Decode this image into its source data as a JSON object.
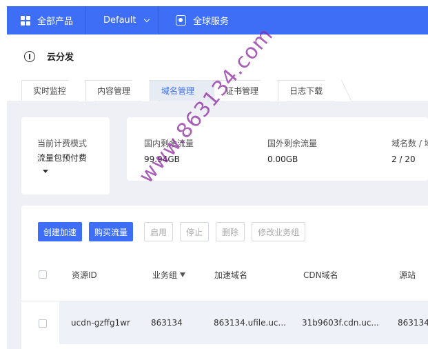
{
  "topnav": {
    "products_label": "全部产品",
    "project_label": "Default",
    "services_label": "全球服务"
  },
  "header": {
    "title": "云分发"
  },
  "tabs": [
    {
      "label": "实时监控",
      "active": false
    },
    {
      "label": "内容管理",
      "active": false
    },
    {
      "label": "域名管理",
      "active": true
    },
    {
      "label": "证书管理",
      "active": false
    },
    {
      "label": "日志下载",
      "active": false
    }
  ],
  "billing": {
    "label": "当前计费模式",
    "value": "流量包预付费"
  },
  "stats": [
    {
      "label": "国内剩余流量",
      "value": "99.94GB"
    },
    {
      "label": "国外剩余流量",
      "value": "0.00GB"
    },
    {
      "label": "域名数 / 域名上限",
      "value": "2 / 20"
    }
  ],
  "toolbar": {
    "create_label": "创建加速",
    "buy_label": "购买流量",
    "start_label": "启用",
    "stop_label": "停止",
    "delete_label": "删除",
    "edit_group_label": "修改业务组"
  },
  "table": {
    "columns": [
      "资源ID",
      "业务组",
      "加速域名",
      "CDN域名",
      "源站"
    ],
    "rows": [
      [
        "ucdn-gzffg1wr",
        "863134",
        "863134.ufile.uc...",
        "31b9603f.cdn.uc...",
        "863134"
      ]
    ]
  },
  "watermark": "www.863134.com",
  "colors": {
    "brand": "#3e6ef6",
    "page_bg": "#eef0f5",
    "watermark": "#8c28a0"
  }
}
